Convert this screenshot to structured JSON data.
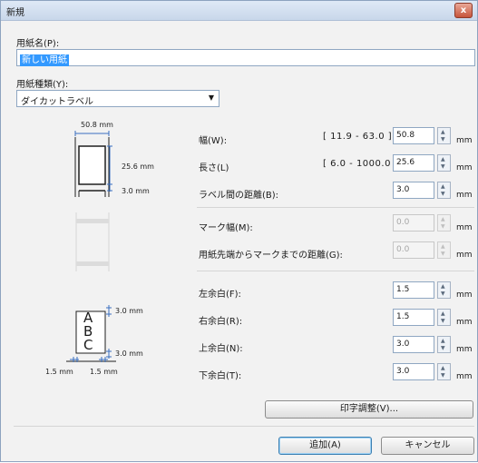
{
  "window": {
    "title": "新規",
    "close_label": "x"
  },
  "paper_name": {
    "label": "用紙名(P):",
    "value": "新しい用紙"
  },
  "paper_type": {
    "label": "用紙種類(Y):",
    "value": "ダイカットラベル"
  },
  "diagram": {
    "width": "50.8 mm",
    "height": "25.6 mm",
    "gap": "3.0 mm",
    "margin_top": "3.0 mm",
    "margin_bottom": "3.0 mm",
    "margin_left": "1.5 mm",
    "margin_right": "1.5 mm",
    "letters": [
      "A",
      "B",
      "C"
    ]
  },
  "fields": {
    "width": {
      "label": "幅(W):",
      "range": "[ 11.9 - 63.0 ]",
      "value": "50.8",
      "unit": "mm"
    },
    "length": {
      "label": "長さ(L)",
      "range": "[ 6.0 - 1000.0 ]",
      "value": "25.6",
      "unit": "mm"
    },
    "label_gap": {
      "label": "ラベル間の距離(B):",
      "value": "3.0",
      "unit": "mm"
    },
    "mark_width": {
      "label": "マーク幅(M):",
      "value": "0.0",
      "unit": "mm"
    },
    "mark_distance": {
      "label": "用紙先端からマークまでの距離(G):",
      "value": "0.0",
      "unit": "mm"
    },
    "left_margin": {
      "label": "左余白(F):",
      "value": "1.5",
      "unit": "mm"
    },
    "right_margin": {
      "label": "右余白(R):",
      "value": "1.5",
      "unit": "mm"
    },
    "top_margin": {
      "label": "上余白(N):",
      "value": "3.0",
      "unit": "mm"
    },
    "bottom_margin": {
      "label": "下余白(T):",
      "value": "3.0",
      "unit": "mm"
    }
  },
  "buttons": {
    "print_adjust": "印字調整(V)...",
    "add": "追加(A)",
    "cancel": "キャンセル"
  }
}
